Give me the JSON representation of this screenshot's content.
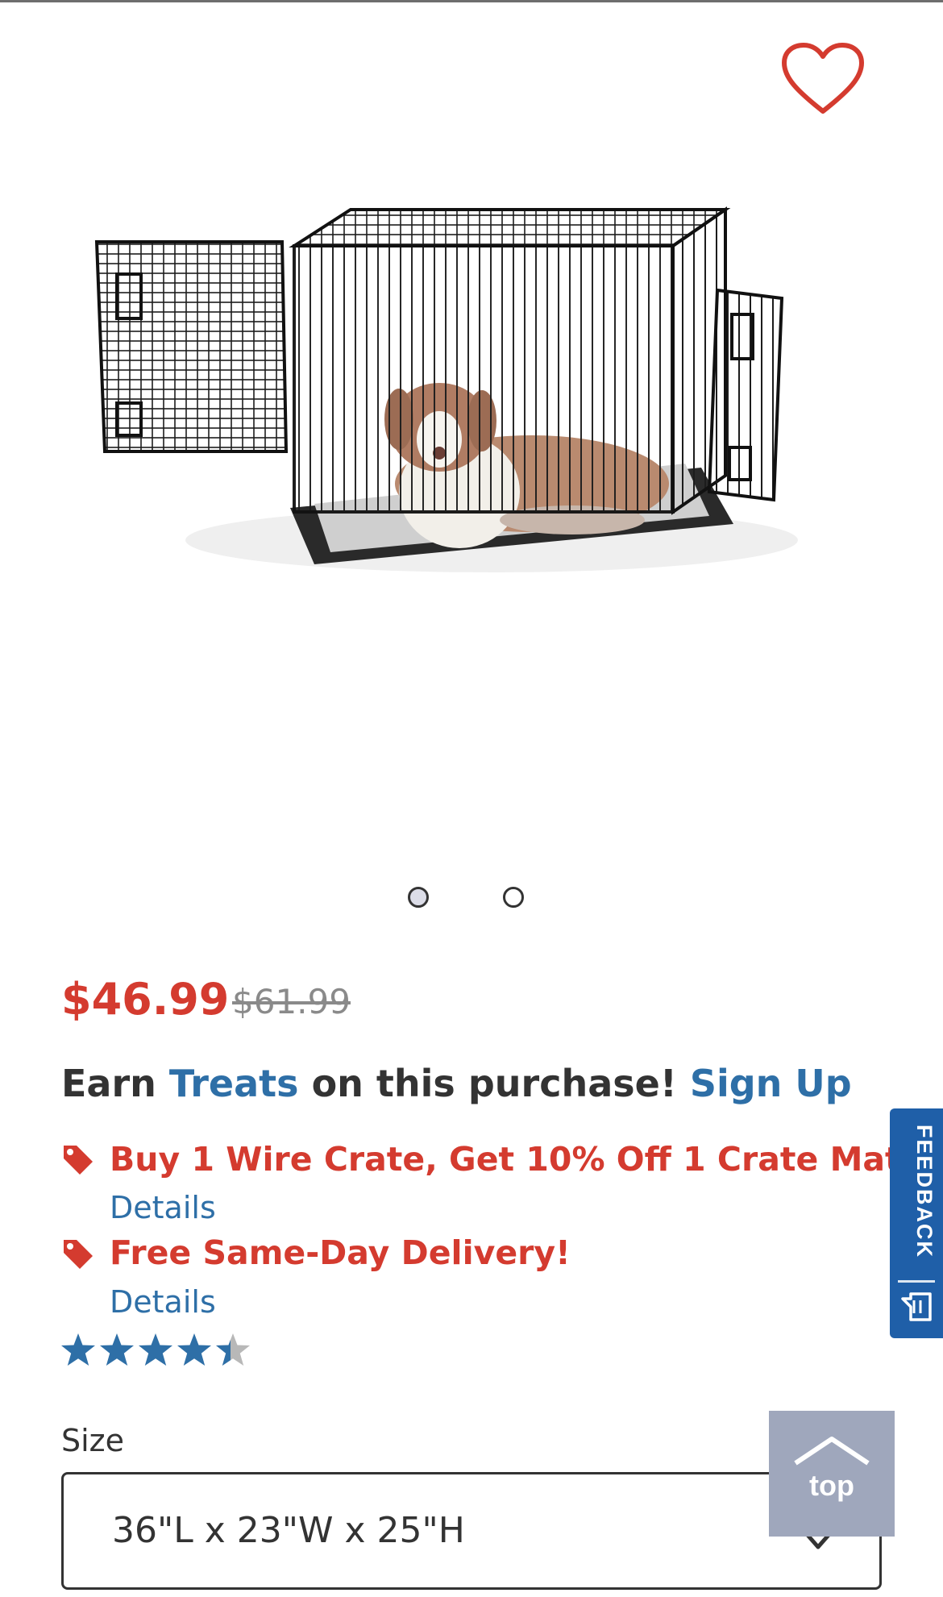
{
  "product": {
    "image_alt": "Dog resting inside a black wire dog crate with two open doors",
    "gallery_dot_count": 2,
    "gallery_active_index": 0
  },
  "pricing": {
    "sale_price": "$46.99",
    "original_price": "$61.99"
  },
  "rewards": {
    "earn_prefix": "Earn",
    "treats_link": "Treats",
    "earn_suffix": "on this purchase!",
    "signup_link": "Sign Up"
  },
  "promotions": [
    {
      "title": "Buy 1 Wire Crate, Get 10% Off 1 Crate Mat",
      "details_label": "Details"
    },
    {
      "title": "Free Same-Day Delivery!",
      "details_label": "Details"
    }
  ],
  "rating": {
    "value": 4.5,
    "max": 5
  },
  "size": {
    "label": "Size",
    "selected": "36\"L x 23\"W x 25\"H"
  },
  "feedback_tab": {
    "label": "FEEDBACK"
  },
  "back_to_top": {
    "label": "top"
  },
  "colors": {
    "price_red": "#d43b2f",
    "link_blue": "#2e6fa7",
    "star_blue": "#2e6fa7",
    "feedback_blue": "#1f5fa8",
    "top_button": "#9fa7bc"
  }
}
